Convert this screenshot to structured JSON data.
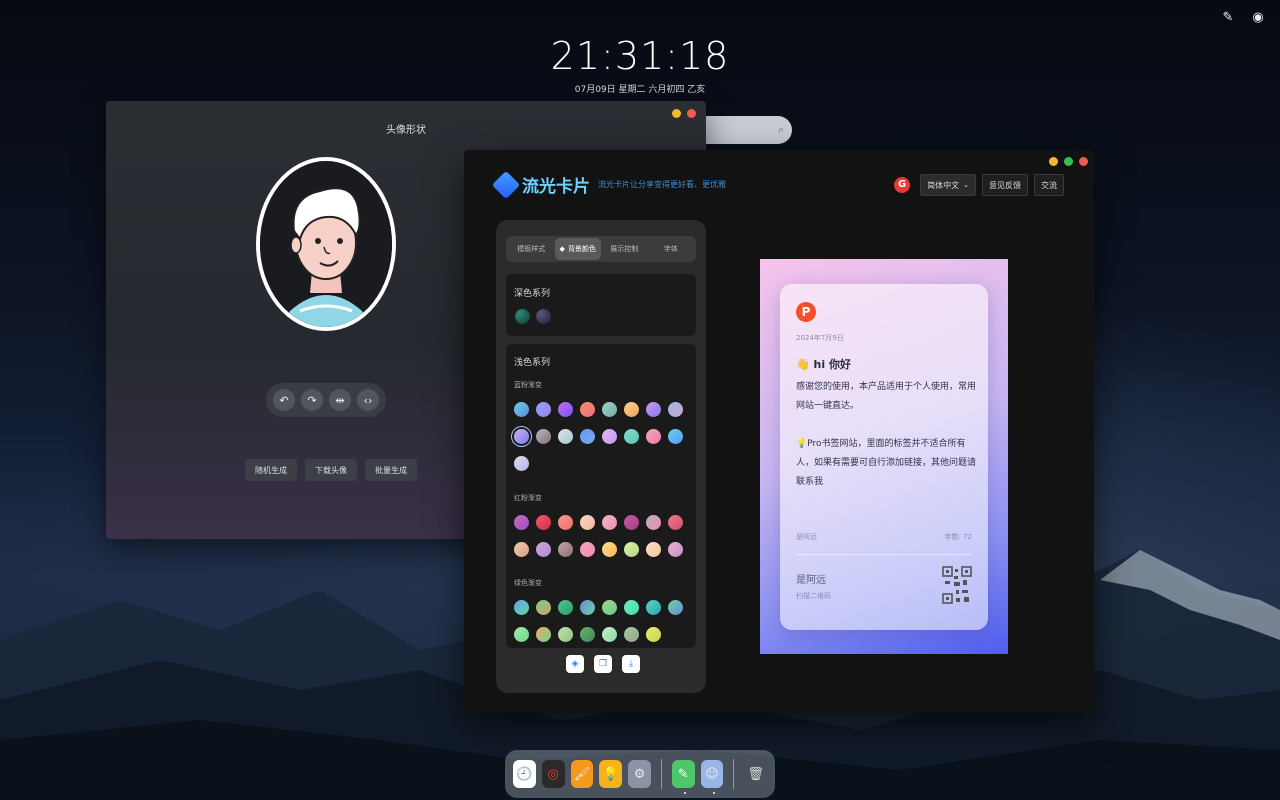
{
  "clock": {
    "time": "21:31:18",
    "date": "07月09日  星期二  六月初四  乙亥"
  },
  "avatar_window": {
    "title": "头像形状",
    "tools": [
      "undo-icon",
      "redo-icon",
      "flip-icon",
      "code-icon"
    ],
    "actions": [
      "随机生成",
      "下载头像",
      "批量生成"
    ]
  },
  "card_window": {
    "brand": {
      "name": "流光卡片",
      "slogan": "流光卡片让分享变得更好看、更优雅"
    },
    "top": {
      "lang": "简体中文",
      "feedback": "意见反馈",
      "chat": "交流"
    },
    "tabs": [
      "模板样式",
      "背景颜色",
      "展示控制",
      "字体"
    ],
    "active_tab": "背景颜色",
    "dark_section": {
      "title": "深色系列"
    },
    "light_section": {
      "title": "浅色系列",
      "groups": [
        {
          "name": "蓝粉渐变"
        },
        {
          "name": "红粉渐变"
        },
        {
          "name": "绿色渐变"
        }
      ]
    },
    "preview": {
      "date": "2024年7月9日",
      "heading": "👋 hi 你好",
      "body1": "感谢您的使用，本产品适用于个人使用，常用网站一键直达。",
      "body2": "💡Pro书签网站，里面的标签并不适合所有人，如果有需要可自行添加链接，其他问题请联系我",
      "author_small": "是阿远",
      "word_count": "字数: 72",
      "author": "是阿远",
      "scan": "扫描二维码"
    }
  },
  "colors": {
    "accent": "#6bd2ff",
    "close": "#f25a4f",
    "minimize": "#f5b731",
    "maximize": "#32c24d"
  }
}
